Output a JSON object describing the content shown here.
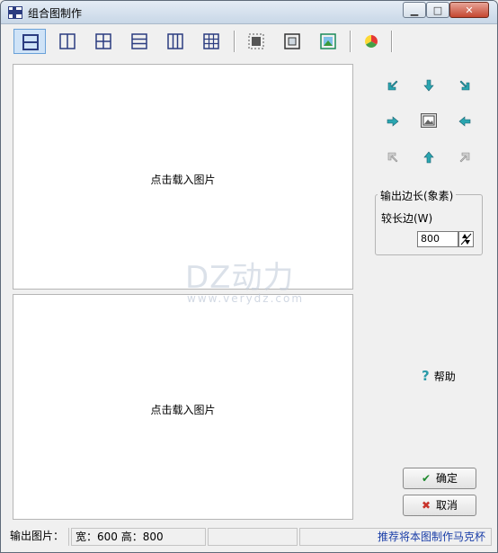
{
  "window": {
    "title": "组合图制作",
    "min_glyph": "▁",
    "max_glyph": "□",
    "close_glyph": "✕"
  },
  "toolbar": {
    "buttons": [
      {
        "name": "layout-2-rows",
        "active": true
      },
      {
        "name": "layout-2-cols",
        "active": false
      },
      {
        "name": "layout-2x2",
        "active": false
      },
      {
        "name": "layout-3-rows",
        "active": false
      },
      {
        "name": "layout-3-cols",
        "active": false
      },
      {
        "name": "layout-3x3",
        "active": false
      },
      {
        "name": "crop",
        "active": false
      },
      {
        "name": "frame",
        "active": false
      },
      {
        "name": "image-resize",
        "active": false
      },
      {
        "name": "color",
        "active": false
      }
    ]
  },
  "panels": {
    "top_label": "点击载入图片",
    "bottom_label": "点击载入图片"
  },
  "watermark": {
    "main": "DZ动力",
    "sub": "www.verydz.com"
  },
  "position_grid": {
    "arrow_color": "#2aa6b0",
    "disabled_color": "#9a9a9a"
  },
  "output_size": {
    "group_title": "输出边长(象素)",
    "longer_side_label": "较长边(W)",
    "value": "800"
  },
  "help": {
    "label": "帮助"
  },
  "buttons": {
    "ok": "确定",
    "cancel": "取消",
    "ok_color": "#1f8a2e",
    "cancel_color": "#c8332b"
  },
  "statusbar": {
    "output_label": "输出图片：",
    "dimensions": "宽：600  高：800",
    "empty1": "",
    "promo": "推荐将本图制作马克杯",
    "promo_color": "#1a3ea8"
  }
}
